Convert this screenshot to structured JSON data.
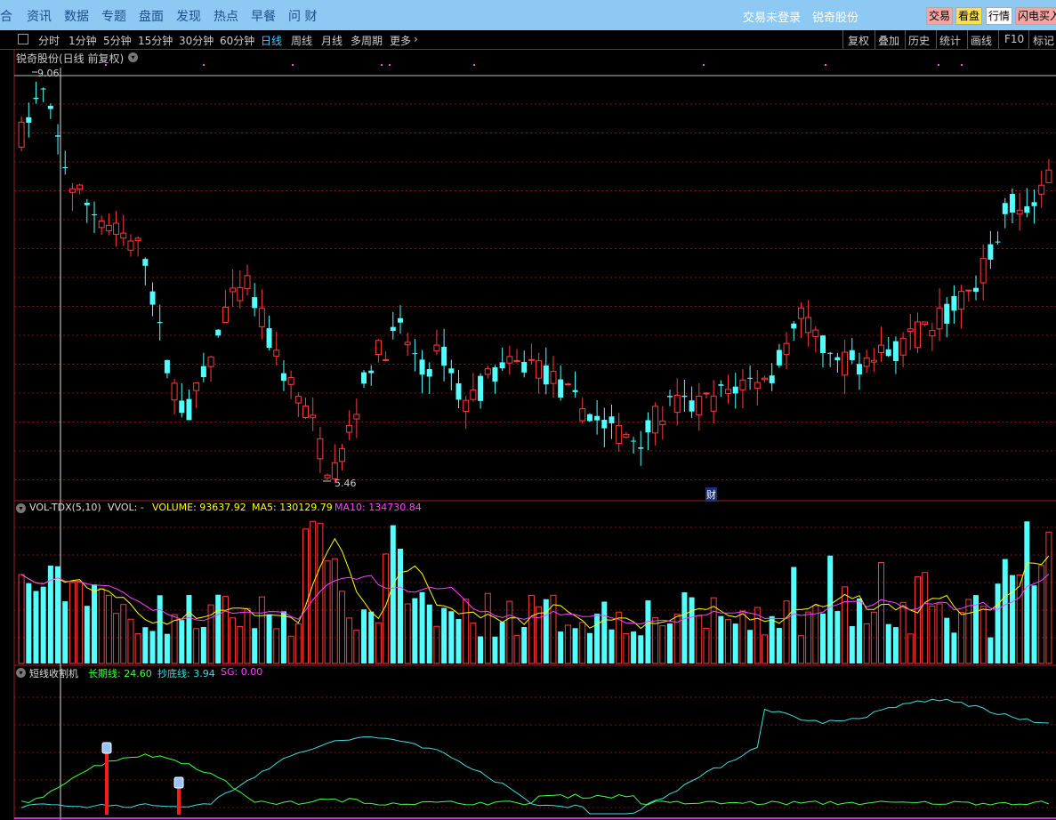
{
  "nav": {
    "items": [
      "综合",
      "资讯",
      "数据",
      "专题",
      "盘面",
      "发现",
      "热点",
      "早餐",
      "问 财"
    ],
    "login": "交易未登录",
    "stock_link": "锐奇股份",
    "quick_buttons": [
      {
        "label": "交易",
        "color": "#f4a4a4"
      },
      {
        "label": "看盘",
        "color": "#ffe24a"
      },
      {
        "label": "行情",
        "color": "#ffffff"
      },
      {
        "label": "闪电买入",
        "color": "#f4a4a4"
      }
    ]
  },
  "periods": {
    "items": [
      "分时",
      "1分钟",
      "5分钟",
      "15分钟",
      "30分钟",
      "60分钟",
      "日线",
      "周线",
      "月线",
      "多周期",
      "更多"
    ],
    "active": "日线"
  },
  "tools": [
    "复权",
    "叠加",
    "历史",
    "统计",
    "画线",
    "F10",
    "标记"
  ],
  "main_panel": {
    "title": "锐奇股份(日线 前复权)",
    "high_label": "9.06",
    "low_label": "5.46",
    "marker_label": "财",
    "price_range": [
      5.3,
      9.1
    ]
  },
  "volume_panel": {
    "indicator": "VOL-TDX(5,10)",
    "vvol": "VVOL: -",
    "volume": "VOLUME: 93637.92",
    "ma5": "MA5: 130129.79",
    "ma10": "MA10: 134730.84",
    "colors": {
      "volume": "#ffff00",
      "ma5": "#ffff00",
      "ma10": "#ff44ff"
    }
  },
  "indicator_panel": {
    "name": "短线收割机",
    "long_line": "长期线: 24.60",
    "bottom_line": "抄底线: 3.94",
    "sg": "SG: 0.00",
    "colors": {
      "long": "#44ff44",
      "bottom": "#44dddd",
      "sg": "#ff44ff"
    }
  },
  "colors": {
    "up": "#ff3b3b",
    "down": "#54ffff",
    "grid": "#7a1515",
    "axis": "#9a2020"
  }
}
